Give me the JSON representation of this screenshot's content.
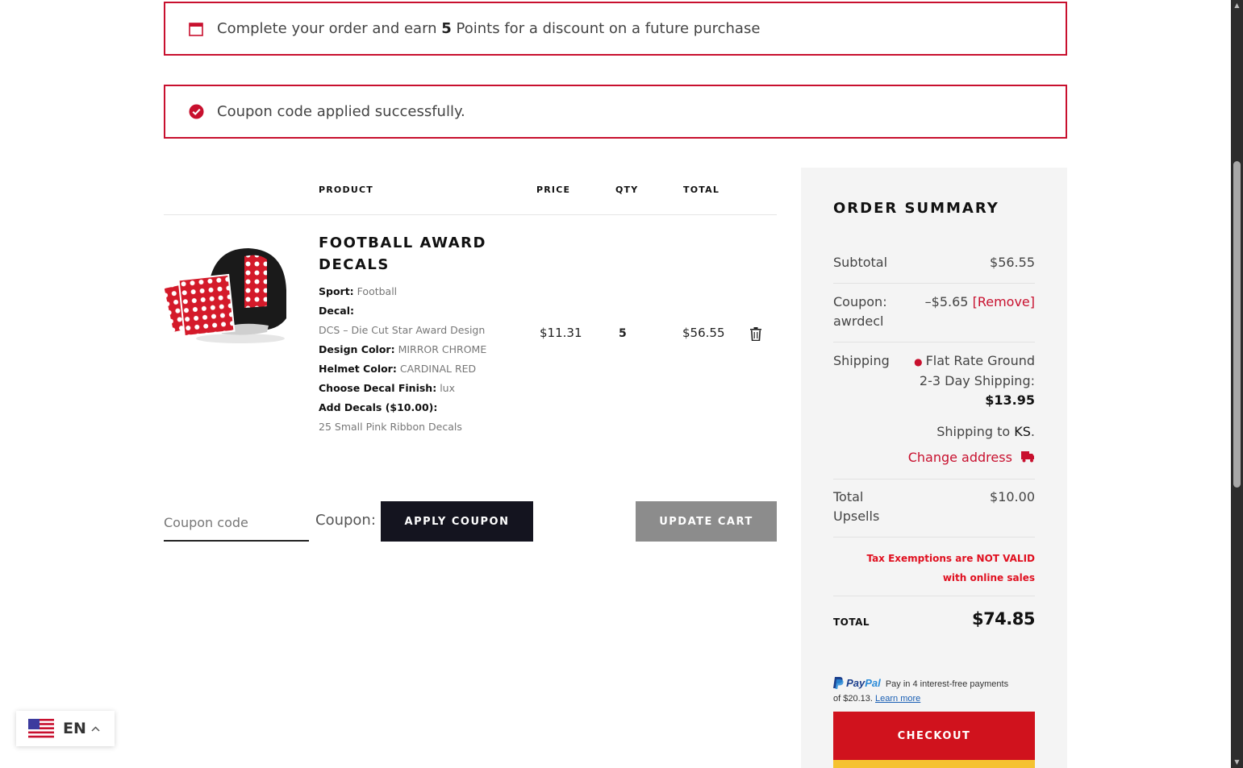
{
  "notices": {
    "points": {
      "before": "Complete your order and earn ",
      "points": "5",
      "after": " Points for a discount on a future purchase"
    },
    "coupon": {
      "message": "Coupon code applied successfully."
    }
  },
  "cart": {
    "headers": {
      "product": "PRODUCT",
      "price": "PRICE",
      "qty": "QTY",
      "total": "TOTAL"
    },
    "item": {
      "title_line1": "FOOTBALL AWARD",
      "title_line2": "DECALS",
      "sport_label": "Sport:",
      "sport_value": "Football",
      "decal_label": "Decal:",
      "decal_value": "DCS – Die Cut Star Award Design",
      "design_color_label": "Design Color:",
      "design_color_value": "MIRROR CHROME",
      "helmet_color_label": "Helmet Color:",
      "helmet_color_value": "CARDINAL RED",
      "finish_label": "Choose Decal Finish:",
      "finish_value": "lux",
      "add_decals_label": "Add Decals ($10.00):",
      "add_decals_value": "25 Small Pink Ribbon Decals",
      "price": "$11.31",
      "qty": "5",
      "total": "$56.55"
    },
    "coupon_placeholder": "Coupon code",
    "coupon_label": "Coupon:",
    "apply_button": "APPLY COUPON",
    "update_button": "UPDATE CART"
  },
  "summary": {
    "title": "ORDER SUMMARY",
    "subtotal_label": "Subtotal",
    "subtotal_value": "$56.55",
    "coupon_label_1": "Coupon:",
    "coupon_label_2": "awrdecl",
    "coupon_value": "–$5.65",
    "coupon_remove": "[Remove]",
    "shipping_label": "Shipping",
    "shipping_method_1": "Flat Rate Ground",
    "shipping_method_2": "2-3 Day Shipping:",
    "shipping_cost": "$13.95",
    "shipping_to_prefix": "Shipping to ",
    "shipping_to_state": "KS",
    "shipping_to_suffix": ".",
    "change_address": "Change address",
    "upsells_label_1": "Total",
    "upsells_label_2": "Upsells",
    "upsells_value": "$10.00",
    "tax_line_1": "Tax Exemptions are NOT VALID",
    "tax_line_2": "with online sales",
    "total_label": "TOTAL",
    "total_value": "$74.85",
    "paypal_brand_1": "Pay",
    "paypal_brand_2": "Pal",
    "paypal_text_1": "Pay in 4 interest-free payments",
    "paypal_text_2": "of $20.13.",
    "paypal_learn": "Learn more",
    "checkout_button": "CHECKOUT"
  },
  "language": {
    "code": "EN"
  },
  "colors": {
    "accent": "#c8102e",
    "dark_button": "#14141f",
    "gray_button": "#8c8c8c",
    "checkout": "#d0121d",
    "panel": "#f4f4f4"
  }
}
